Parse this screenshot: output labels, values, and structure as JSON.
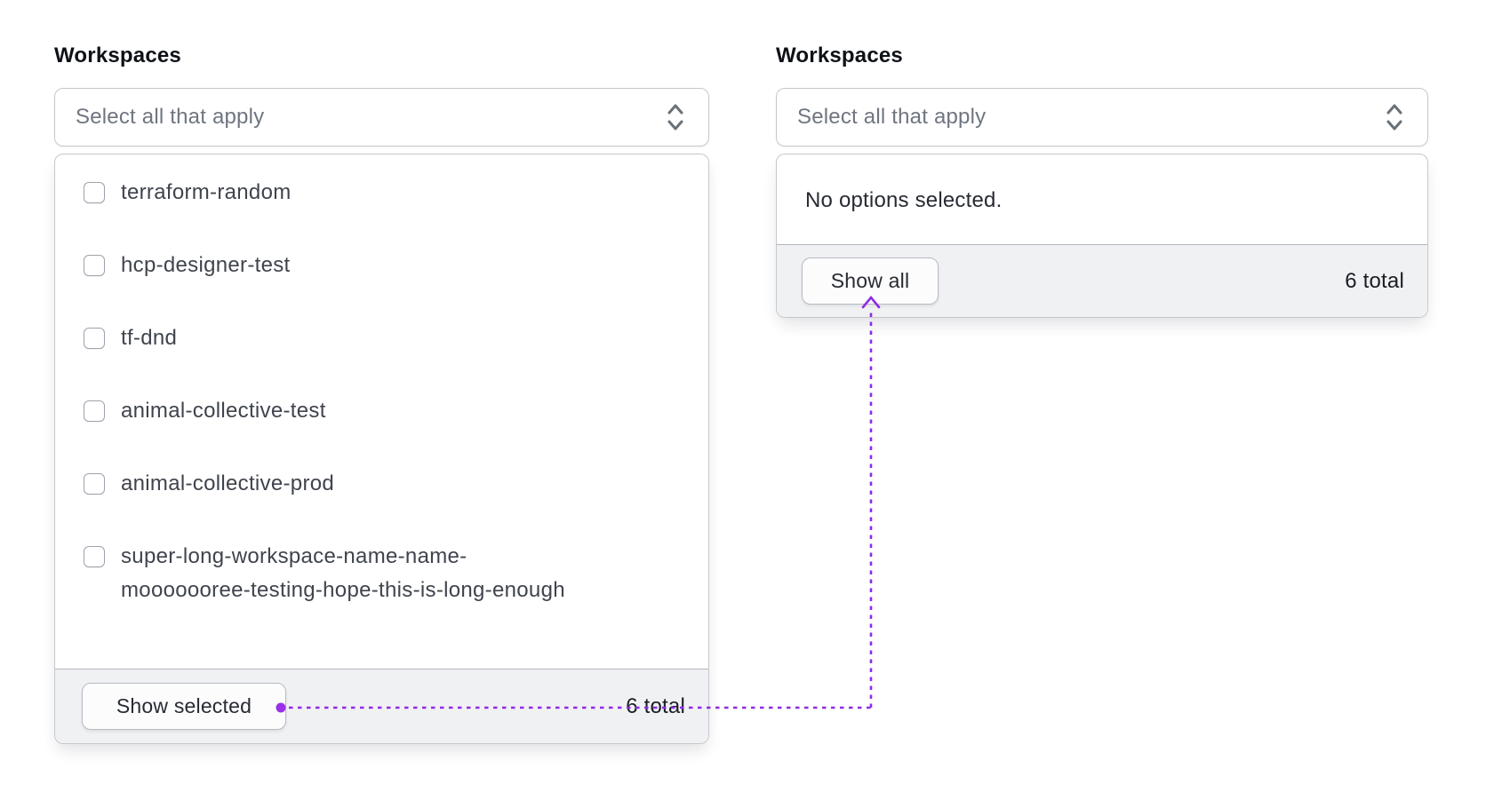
{
  "page": {
    "background": "#ffffff"
  },
  "annotation": {
    "color": "#8f2be6",
    "description": "dotted connector arrow from Show selected button to Show all button"
  },
  "left_panel": {
    "label": "Workspaces",
    "select": {
      "placeholder": "Select all that apply"
    },
    "options": [
      {
        "label": "terraform-random",
        "checked": false
      },
      {
        "label": "hcp-designer-test",
        "checked": false
      },
      {
        "label": "tf-dnd",
        "checked": false
      },
      {
        "label": "animal-collective-test",
        "checked": false
      },
      {
        "label": "animal-collective-prod",
        "checked": false
      },
      {
        "label": "super-long-workspace-name-name-mooooooree-testing-hope-this-is-long-enough",
        "checked": false
      }
    ],
    "footer": {
      "button": "Show selected",
      "total": "6 total"
    }
  },
  "right_panel": {
    "label": "Workspaces",
    "select": {
      "placeholder": "Select all that apply"
    },
    "empty_state": "No options selected.",
    "footer": {
      "button": "Show all",
      "total": "6 total"
    }
  }
}
